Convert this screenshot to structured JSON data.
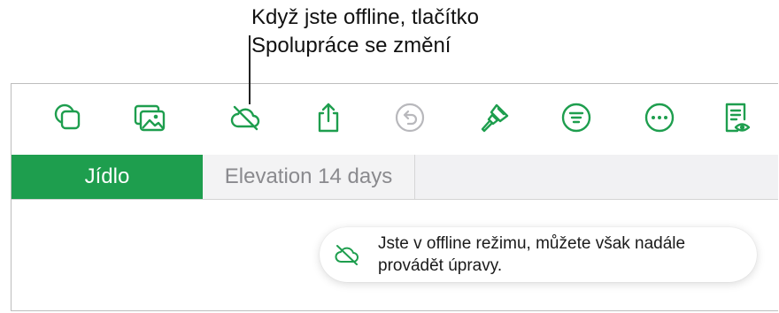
{
  "callout": {
    "line1": "Když jste offline, tlačítko",
    "line2": "Spolupráce se změní"
  },
  "toolbar": {
    "icons": [
      "shapes-icon",
      "media-icon",
      "collaboration-offline-icon",
      "share-icon",
      "undo-icon",
      "format-brush-icon",
      "organize-icon",
      "more-icon",
      "document-view-icon"
    ],
    "accent_color": "#1e9e4e",
    "disabled_color": "#b8b8bc"
  },
  "tabs": {
    "active_label": "Jídlo",
    "inactive_label": "Elevation 14 days"
  },
  "toast": {
    "icon": "cloud-offline-icon",
    "line1": "Jste v offline režimu, můžete však nadále",
    "line2": "provádět úpravy."
  }
}
